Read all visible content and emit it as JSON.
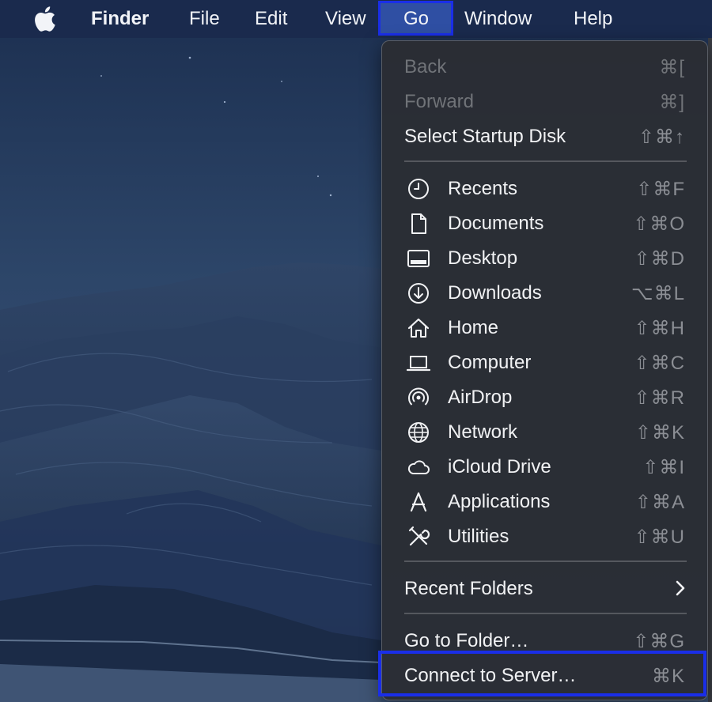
{
  "menubar": {
    "app_name": "Finder",
    "items": [
      "File",
      "Edit",
      "View",
      "Go",
      "Window",
      "Help"
    ],
    "active": "Go",
    "icons": {
      "apple": "apple-logo-icon"
    }
  },
  "go_menu": {
    "nav": [
      {
        "label": "Back",
        "shortcut": "⌘[",
        "disabled": true
      },
      {
        "label": "Forward",
        "shortcut": "⌘]",
        "disabled": true
      },
      {
        "label": "Select Startup Disk",
        "shortcut": "⇧⌘↑",
        "disabled": false
      }
    ],
    "places": [
      {
        "label": "Recents",
        "shortcut": "⇧⌘F",
        "icon": "clock-icon"
      },
      {
        "label": "Documents",
        "shortcut": "⇧⌘O",
        "icon": "document-icon"
      },
      {
        "label": "Desktop",
        "shortcut": "⇧⌘D",
        "icon": "desktop-icon"
      },
      {
        "label": "Downloads",
        "shortcut": "⌥⌘L",
        "icon": "download-icon"
      },
      {
        "label": "Home",
        "shortcut": "⇧⌘H",
        "icon": "home-icon"
      },
      {
        "label": "Computer",
        "shortcut": "⇧⌘C",
        "icon": "laptop-icon"
      },
      {
        "label": "AirDrop",
        "shortcut": "⇧⌘R",
        "icon": "airdrop-icon"
      },
      {
        "label": "Network",
        "shortcut": "⇧⌘K",
        "icon": "globe-icon"
      },
      {
        "label": "iCloud Drive",
        "shortcut": "⇧⌘I",
        "icon": "cloud-icon"
      },
      {
        "label": "Applications",
        "shortcut": "⇧⌘A",
        "icon": "applications-icon"
      },
      {
        "label": "Utilities",
        "shortcut": "⇧⌘U",
        "icon": "tools-icon"
      }
    ],
    "recent_folders": {
      "label": "Recent Folders",
      "icon": "chevron-right-icon"
    },
    "tail": [
      {
        "label": "Go to Folder…",
        "shortcut": "⇧⌘G"
      },
      {
        "label": "Connect to Server…",
        "shortcut": "⌘K",
        "highlighted": true
      }
    ]
  },
  "colors": {
    "menubar_bg": "#1a2a4d",
    "menu_bg": "#2a2d34",
    "highlight_border": "#1a2ee8",
    "shortcut_text": "#8b8e94"
  }
}
